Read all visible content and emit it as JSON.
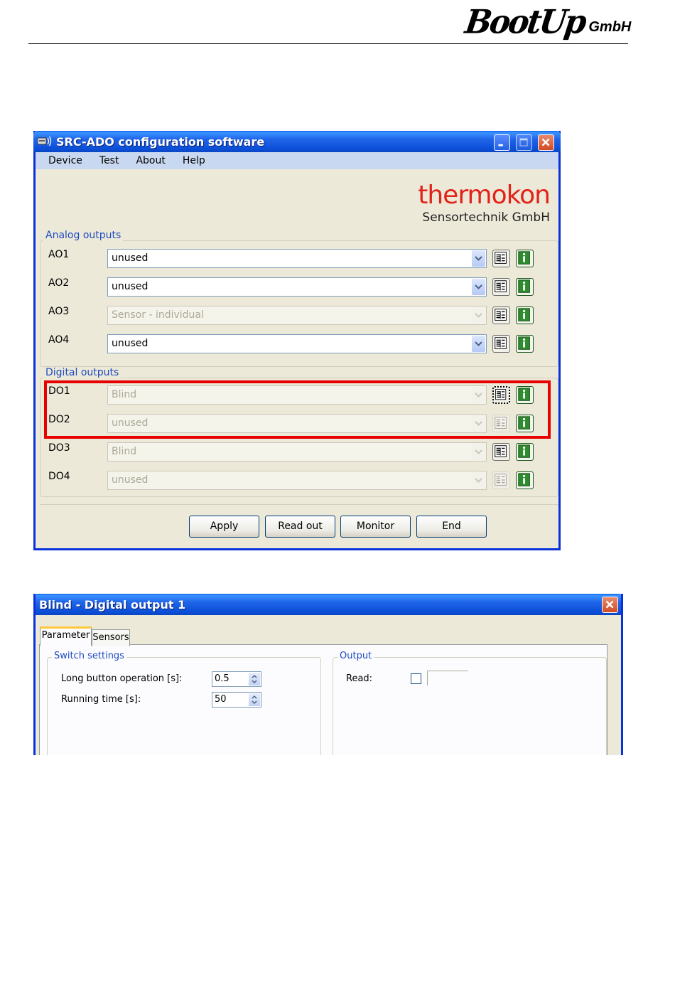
{
  "document_header": {
    "logo_big": "BootUp",
    "logo_small": "GmbH"
  },
  "main_window": {
    "title": "SRC-ADO configuration software",
    "menu": [
      "Device",
      "Test",
      "About",
      "Help"
    ],
    "brand_logo_top": "thermokon",
    "brand_logo_bottom": "Sensortechnik GmbH",
    "analog_group_label": "Analog outputs",
    "digital_group_label": "Digital outputs",
    "analog_outputs": [
      {
        "label": "AO1",
        "value": "unused",
        "enabled": true
      },
      {
        "label": "AO2",
        "value": "unused",
        "enabled": true
      },
      {
        "label": "AO3",
        "value": "Sensor - individual",
        "enabled": false
      },
      {
        "label": "AO4",
        "value": "unused",
        "enabled": true
      }
    ],
    "digital_outputs": [
      {
        "label": "DO1",
        "value": "Blind",
        "enabled": false,
        "config_enabled": true
      },
      {
        "label": "DO2",
        "value": "unused",
        "enabled": false,
        "config_enabled": false
      },
      {
        "label": "DO3",
        "value": "Blind",
        "enabled": false,
        "config_enabled": true
      },
      {
        "label": "DO4",
        "value": "unused",
        "enabled": false,
        "config_enabled": false
      }
    ],
    "buttons": {
      "apply": "Apply",
      "read_out": "Read out",
      "monitor": "Monitor",
      "end": "End"
    },
    "icons": {
      "config": "config-icon",
      "info": "info-icon"
    }
  },
  "blind_dialog": {
    "title": "Blind - Digital output 1",
    "tabs": [
      "Parameter",
      "Sensors"
    ],
    "switch_settings": {
      "group_label": "Switch settings",
      "long_button_label": "Long button operation [s]:",
      "long_button_value": "0.5",
      "running_time_label": "Running time [s]:",
      "running_time_value": "50"
    },
    "output": {
      "group_label": "Output",
      "read_label": "Read:"
    }
  },
  "colors": {
    "xp_blue": "#0831d9",
    "window_face": "#ece9d8",
    "group_label_blue": "#1f4ac2",
    "highlight_red": "#e60000",
    "thermokon_red": "#e2231a"
  }
}
